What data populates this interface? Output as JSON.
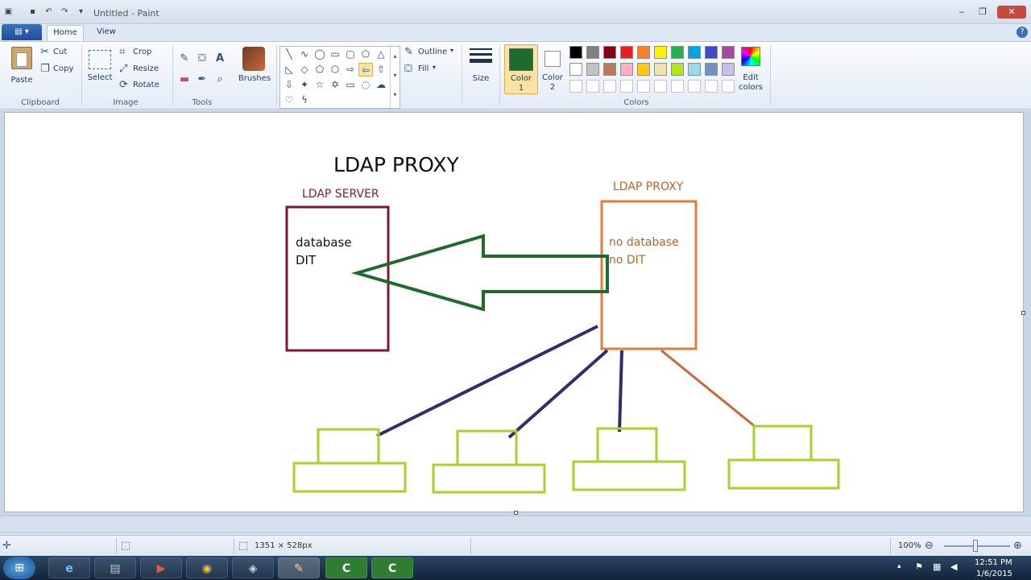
{
  "window": {
    "title": "Untitled - Paint"
  },
  "tabs": {
    "file": "▤ ▾",
    "home": "Home",
    "view": "View"
  },
  "ribbon": {
    "clipboard": {
      "paste": "Paste",
      "cut": "Cut",
      "copy": "Copy",
      "label": "Clipboard"
    },
    "image": {
      "select": "Select",
      "crop": "Crop",
      "resize": "Resize",
      "rotate": "Rotate",
      "label": "Image"
    },
    "tools": {
      "label": "Tools",
      "brushes": "Brushes"
    },
    "shapes": {
      "outline": "Outline",
      "fill": "Fill"
    },
    "size": {
      "label": "Size"
    },
    "color1": {
      "label": "Color",
      "num": "1",
      "value": "#1e6b2e"
    },
    "color2": {
      "label": "Color",
      "num": "2",
      "value": "#ffffff"
    },
    "colors": {
      "label": "Colors",
      "row1": [
        "#000000",
        "#7f7f7f",
        "#880015",
        "#ed1c24",
        "#ff7f27",
        "#fff200",
        "#22b14c",
        "#00a2e8",
        "#3f48cc",
        "#a349a4"
      ],
      "row2": [
        "#ffffff",
        "#c3c3c3",
        "#b97a57",
        "#ffaec9",
        "#ffc90e",
        "#efe4b0",
        "#b5e61d",
        "#99d9ea",
        "#7092be",
        "#c8bfe7"
      ]
    },
    "edit_colors": {
      "line1": "Edit",
      "line2": "colors"
    }
  },
  "diagram": {
    "title": "LDAP PROXY",
    "server": {
      "label": "LDAP SERVER",
      "line1": "database",
      "line2": "DIT"
    },
    "proxy": {
      "label": "LDAP PROXY",
      "line1": "no database",
      "line2": "no DIT"
    }
  },
  "status": {
    "size": "1351 × 528px",
    "zoom": "100%"
  },
  "taskbar": {
    "time": "12:51 PM",
    "date": "1/6/2015"
  }
}
